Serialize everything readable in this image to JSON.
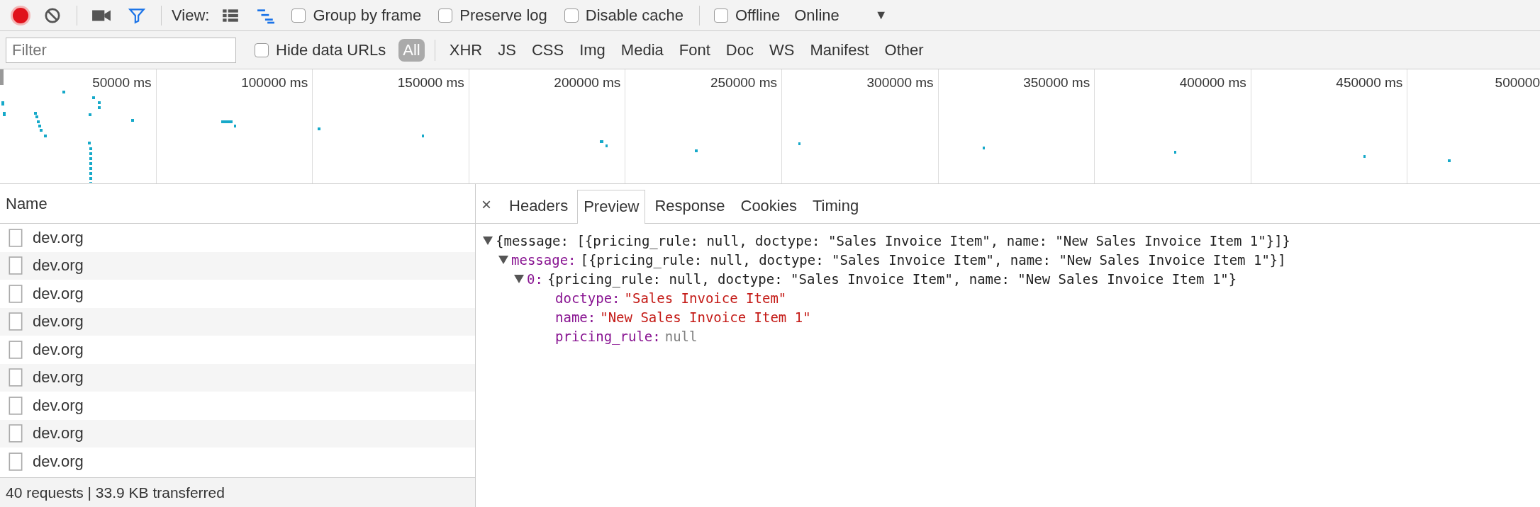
{
  "toolbar": {
    "recording": true,
    "filter_active": true,
    "view_label": "View:",
    "view_modes": [
      {
        "kind": "list",
        "selected": false
      },
      {
        "kind": "waterfall",
        "selected": true
      }
    ],
    "checkboxes": [
      {
        "label": "Group by frame",
        "checked": false
      },
      {
        "label": "Preserve log",
        "checked": false
      },
      {
        "label": "Disable cache",
        "checked": false
      },
      {
        "label": "Offline",
        "checked": false
      }
    ],
    "throttling": {
      "value": "Online",
      "arrow": "▼"
    }
  },
  "filter_bar": {
    "placeholder": "Filter",
    "hide_data_urls": {
      "label": "Hide data URLs",
      "checked": false
    },
    "types": [
      {
        "label": "All",
        "selected": true
      },
      {
        "label": "XHR",
        "selected": false
      },
      {
        "label": "JS",
        "selected": false
      },
      {
        "label": "CSS",
        "selected": false
      },
      {
        "label": "Img",
        "selected": false
      },
      {
        "label": "Media",
        "selected": false
      },
      {
        "label": "Font",
        "selected": false
      },
      {
        "label": "Doc",
        "selected": false
      },
      {
        "label": "WS",
        "selected": false
      },
      {
        "label": "Manifest",
        "selected": false
      },
      {
        "label": "Other",
        "selected": false
      }
    ]
  },
  "timeline": {
    "ticks": [
      "50000 ms",
      "100000 ms",
      "150000 ms",
      "200000 ms",
      "250000 ms",
      "300000 ms",
      "350000 ms",
      "400000 ms",
      "450000 ms",
      "500000"
    ]
  },
  "requests": {
    "column": "Name",
    "rows": [
      "dev.org",
      "dev.org",
      "dev.org",
      "dev.org",
      "dev.org",
      "dev.org",
      "dev.org",
      "dev.org",
      "dev.org"
    ]
  },
  "details": {
    "close": "×",
    "tabs": [
      {
        "label": "Headers",
        "selected": false
      },
      {
        "label": "Preview",
        "selected": true
      },
      {
        "label": "Response",
        "selected": false
      },
      {
        "label": "Cookies",
        "selected": false
      },
      {
        "label": "Timing",
        "selected": false
      }
    ],
    "preview": [
      {
        "summary": "{message: [{pricing_rule: null, doctype: \"Sales Invoice Item\", name: \"New Sales Invoice Item 1\"}]}",
        "expanded": true,
        "children": [
          {
            "key": "message:",
            "summary": "[{pricing_rule: null, doctype: \"Sales Invoice Item\", name: \"New Sales Invoice Item 1\"}]",
            "expanded": true,
            "children": [
              {
                "key": "0:",
                "summary": "{pricing_rule: null, doctype: \"Sales Invoice Item\", name: \"New Sales Invoice Item 1\"}",
                "expanded": true,
                "children": [
                  {
                    "key": "doctype:",
                    "value": "\"Sales Invoice Item\"",
                    "kind": "string"
                  },
                  {
                    "key": "name:",
                    "value": "\"New Sales Invoice Item 1\"",
                    "kind": "string"
                  },
                  {
                    "key": "pricing_rule:",
                    "value": "null",
                    "kind": "null"
                  }
                ]
              }
            ]
          }
        ]
      }
    ]
  },
  "status_bar": "40 requests | 33.9 KB transferred"
}
